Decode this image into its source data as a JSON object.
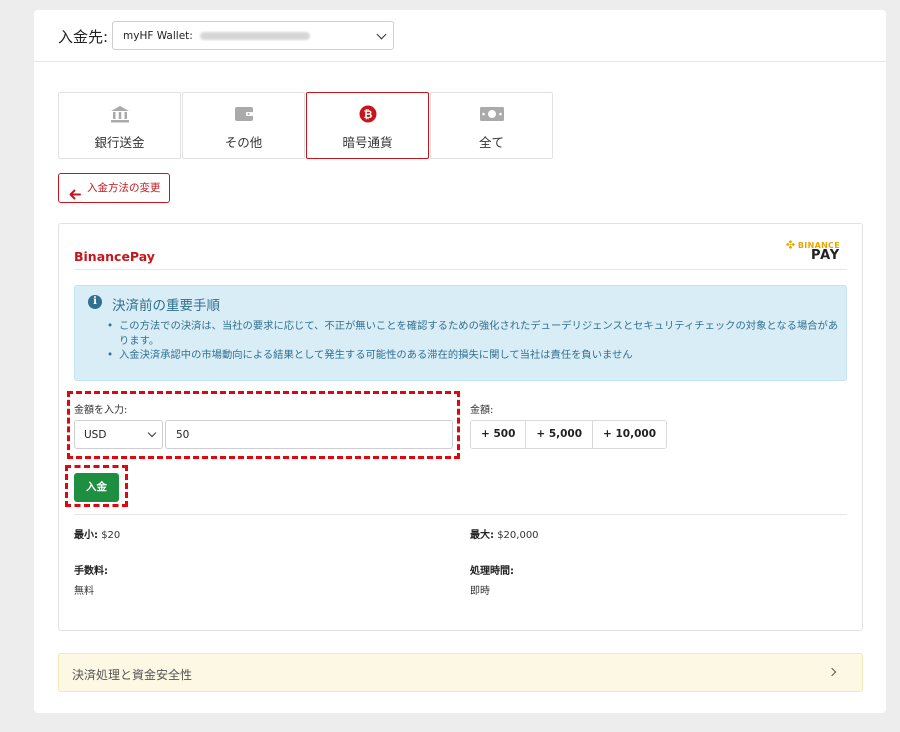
{
  "header": {
    "destination_label": "入金先:",
    "wallet_select_value": "myHF Wallet:"
  },
  "tabs": [
    {
      "label": "銀行送金",
      "icon": "bank-icon",
      "active": false
    },
    {
      "label": "その他",
      "icon": "wallet-icon",
      "active": false
    },
    {
      "label": "暗号通貨",
      "icon": "bitcoin-icon",
      "active": true
    },
    {
      "label": "全て",
      "icon": "cash-icon",
      "active": false
    }
  ],
  "back_button": {
    "label": "入金方法の変更"
  },
  "method": {
    "title": "BinancePay",
    "logo_top": "BINANCE",
    "logo_bottom": "PAY"
  },
  "notice": {
    "title": "決済前の重要手順",
    "items": [
      "この方法での決済は、当社の要求に応じて、不正が無いことを確認するための強化されたデューデリジェンスとセキュリティチェックの対象となる場合があります。",
      "入金決済承認中の市場動向による結果として発生する可能性のある滞在的損失に関して当社は責任を負いません"
    ]
  },
  "form": {
    "amount_label": "金額を入力:",
    "currency_value": "USD",
    "amount_value": "50",
    "quick_label": "金額:",
    "quick_amounts": [
      "+ 500",
      "+ 5,000",
      "+ 10,000"
    ],
    "deposit_button": "入金"
  },
  "limits": {
    "min_label": "最小:",
    "min_value": "$20",
    "max_label": "最大:",
    "max_value": "$20,000",
    "fee_label": "手数料:",
    "fee_value": "無料",
    "time_label": "処理時間:",
    "time_value": "即時"
  },
  "accordion": {
    "title": "決済処理と資金安全性"
  },
  "colors": {
    "brand_red": "#c4161c",
    "deposit_green": "#1e8f41",
    "info_bg": "#d9edf7",
    "info_text": "#31708f",
    "highlight_dash": "#e0060e",
    "binance_yellow": "#e6a800"
  }
}
